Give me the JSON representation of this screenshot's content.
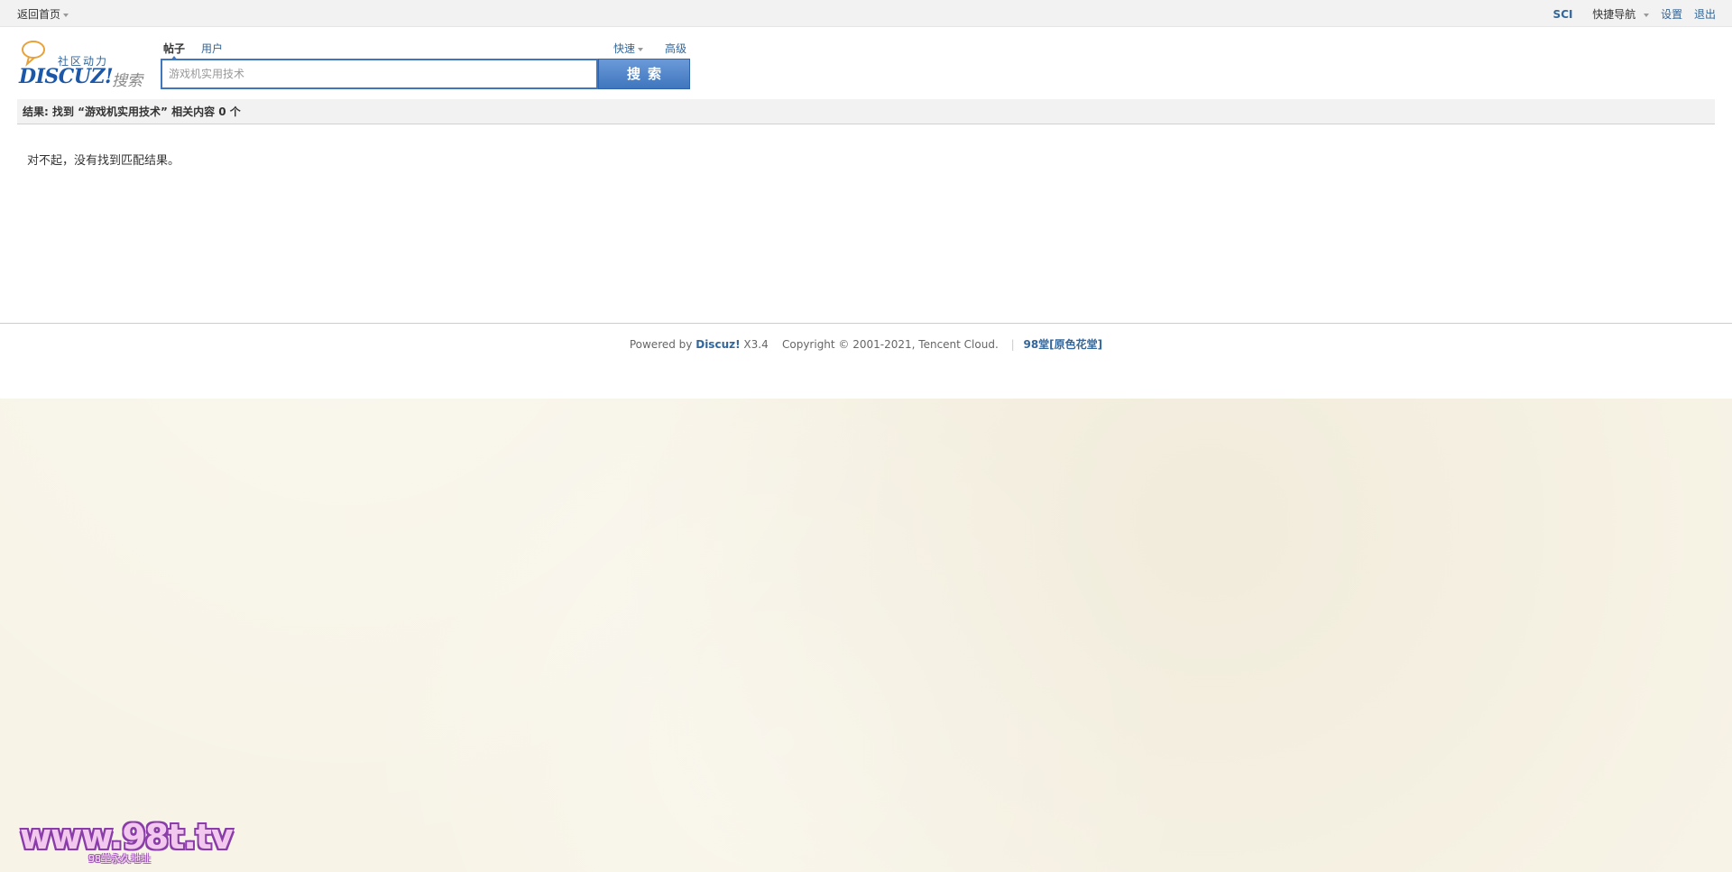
{
  "topbar": {
    "home_label": "返回首页",
    "username": "SCI",
    "quick_nav": "快捷导航",
    "settings": "设置",
    "logout": "退出"
  },
  "logo": {
    "cn": "社区动力",
    "brand": "DISCUZ!",
    "sub": "搜索"
  },
  "search": {
    "tab_posts": "帖子",
    "tab_users": "用户",
    "quick": "快速",
    "advanced": "高级",
    "placeholder": "游戏机实用技术",
    "button": "搜索"
  },
  "result": {
    "summary": "结果: 找到 “游戏机实用技术” 相关内容 0 个",
    "empty_message": "对不起，没有找到匹配结果。"
  },
  "footer": {
    "powered": "Powered by",
    "brand": "Discuz!",
    "version": "X3.4",
    "copyright": "Copyright © 2001-2021, Tencent Cloud.",
    "pipe": "|",
    "site": "98堂[原色花堂]"
  },
  "watermark": {
    "main": "www.98t.tv",
    "sub": "98堂永久地址"
  },
  "colors": {
    "link": "#336699",
    "accent": "#3f76bd",
    "background": "#f7f3e6"
  }
}
